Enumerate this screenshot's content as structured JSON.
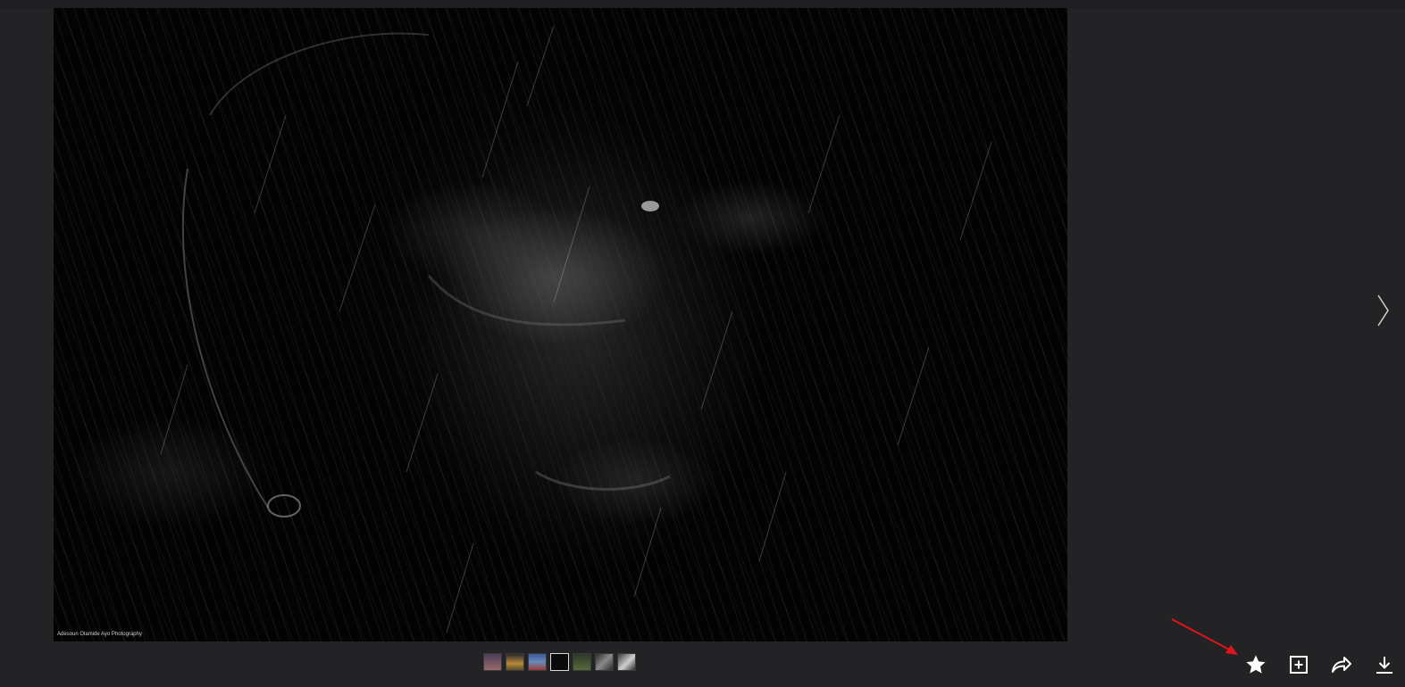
{
  "photo": {
    "credit": "Adesoun Olamide Ayo Photography"
  },
  "thumbnails": {
    "count": 7,
    "active_index": 3,
    "colors": [
      "#6a5a7a",
      "#8a6a3a",
      "#4a6a9a",
      "#0a0a0a",
      "#3a4a3a",
      "#5a5a5a",
      "#7a7a7a"
    ]
  },
  "actions": {
    "favorite": "star-icon",
    "add_to_collection": "plus-square-icon",
    "share": "share-icon",
    "download": "download-icon"
  },
  "colors": {
    "background": "#232325",
    "icon": "#ffffff",
    "annotation_arrow": "#e0141b"
  }
}
